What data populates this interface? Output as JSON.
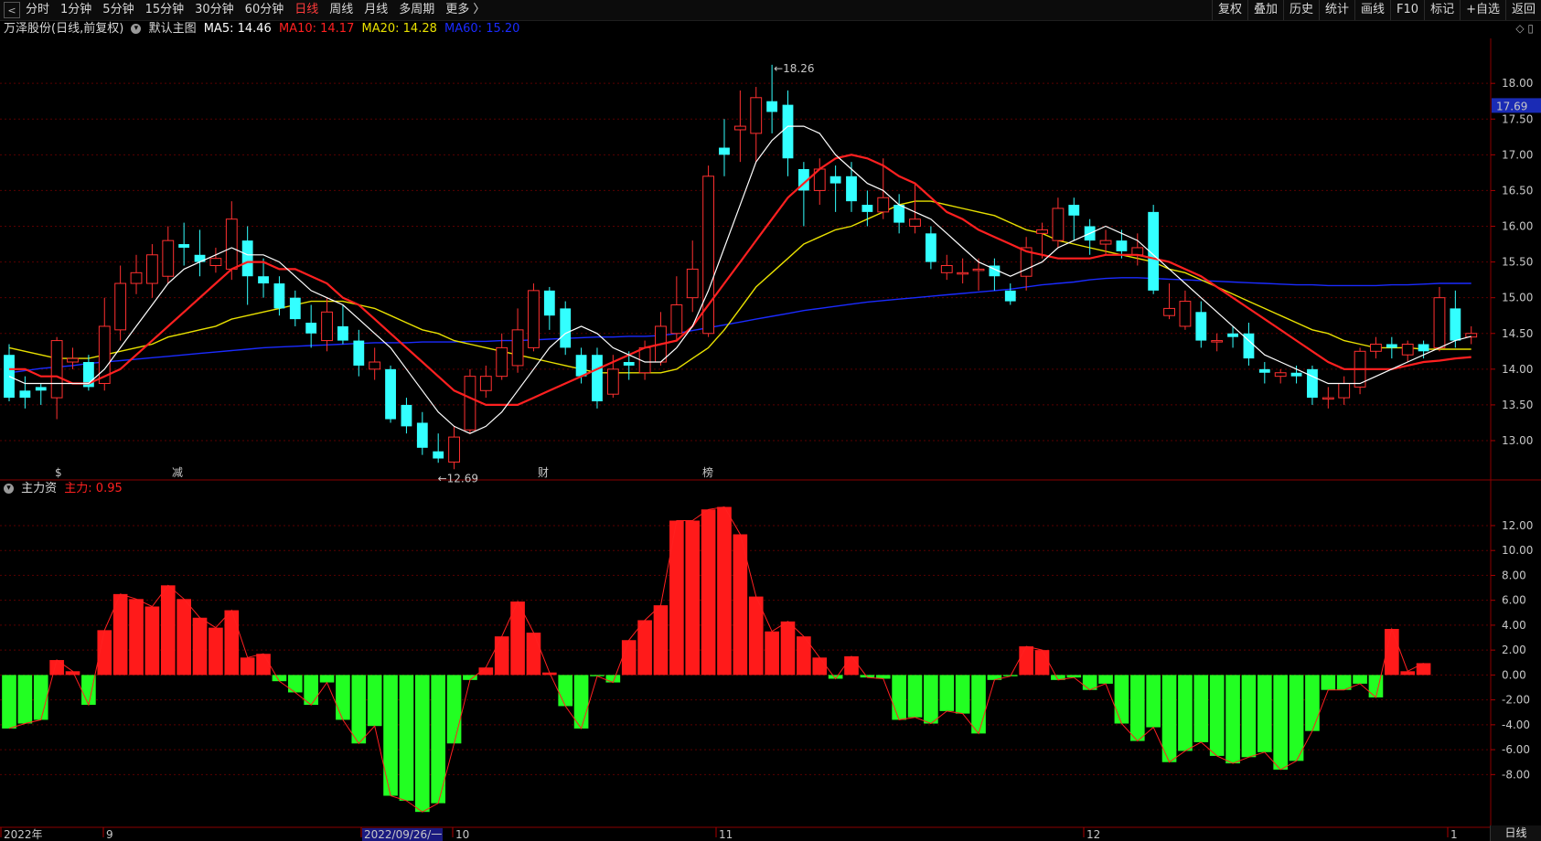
{
  "toolbar": {
    "back_icon": "back-arrow-icon",
    "periods": [
      "分时",
      "1分钟",
      "5分钟",
      "15分钟",
      "30分钟",
      "60分钟",
      "日线",
      "周线",
      "月线",
      "多周期",
      "更多 〉"
    ],
    "active_period": "日线",
    "right_tools": [
      "复权",
      "叠加",
      "历史",
      "统计",
      "画线",
      "F10",
      "标记",
      "+自选",
      "返回"
    ]
  },
  "main_info": {
    "stock": "万泽股份(日线,前复权)",
    "chart_name": "默认主图",
    "ma5": "MA5: 14.46",
    "ma10": "MA10: 14.17",
    "ma20": "MA20: 14.28",
    "ma60": "MA60: 15.20",
    "ma5_color": "#ffffff",
    "ma10_color": "#ff2020",
    "ma20_color": "#e8e000",
    "ma60_color": "#1a2bff"
  },
  "indicator_info": {
    "name": "主力资",
    "value": "主力: 0.95"
  },
  "price_axis_labels": [
    "18.00",
    "17.50",
    "17.00",
    "16.50",
    "16.00",
    "15.50",
    "15.00",
    "14.50",
    "14.00",
    "13.50",
    "13.00"
  ],
  "current_price": "17.69",
  "high_label": "18.26",
  "low_label": "12.69",
  "event_markers": [
    "$",
    "减",
    "财",
    "榜"
  ],
  "indicator_axis_labels": [
    "12.00",
    "10.00",
    "8.00",
    "6.00",
    "4.00",
    "2.00",
    "0.00",
    "-2.00",
    "-4.00",
    "-6.00",
    "-8.00"
  ],
  "date_labels": [
    "2022年",
    "9",
    "2022/09/26/一",
    "10",
    "11",
    "12",
    "1"
  ],
  "bottom_right_label": "日线",
  "colors": {
    "up": "#ff3030",
    "down": "#33ffff",
    "fund_up": "#ff1a1a",
    "fund_down": "#22ff22",
    "grid": "#5a0000",
    "background": "#000000"
  },
  "chart_data": [
    {
      "type": "candlestick",
      "title": "万泽股份(日线,前复权)",
      "ylim": [
        12.6,
        18.3
      ],
      "candles": [
        [
          14.2,
          13.6,
          14.35,
          13.55
        ],
        [
          13.7,
          13.6,
          13.9,
          13.45
        ],
        [
          13.75,
          13.7,
          13.8,
          13.5
        ],
        [
          13.6,
          14.4,
          14.45,
          13.3
        ],
        [
          14.1,
          14.15,
          14.3,
          14.0
        ],
        [
          14.1,
          13.75,
          14.2,
          13.7
        ],
        [
          13.8,
          14.6,
          15.0,
          13.7
        ],
        [
          14.55,
          15.2,
          15.45,
          14.4
        ],
        [
          15.2,
          15.35,
          15.6,
          15.05
        ],
        [
          15.2,
          15.6,
          15.75,
          15.0
        ],
        [
          15.3,
          15.8,
          16.0,
          15.2
        ],
        [
          15.75,
          15.7,
          16.05,
          15.45
        ],
        [
          15.6,
          15.5,
          15.95,
          15.3
        ],
        [
          15.45,
          15.55,
          15.7,
          15.35
        ],
        [
          15.4,
          16.1,
          16.35,
          15.25
        ],
        [
          15.8,
          15.3,
          16.0,
          14.9
        ],
        [
          15.3,
          15.2,
          15.55,
          15.0
        ],
        [
          15.2,
          14.85,
          15.3,
          14.75
        ],
        [
          15.0,
          14.7,
          15.1,
          14.6
        ],
        [
          14.65,
          14.5,
          14.9,
          14.3
        ],
        [
          14.4,
          14.8,
          15.0,
          14.25
        ],
        [
          14.6,
          14.4,
          14.9,
          14.35
        ],
        [
          14.4,
          14.05,
          14.55,
          13.9
        ],
        [
          14.0,
          14.1,
          14.3,
          13.85
        ],
        [
          14.0,
          13.3,
          14.05,
          13.25
        ],
        [
          13.5,
          13.2,
          13.6,
          13.1
        ],
        [
          13.25,
          12.9,
          13.4,
          12.8
        ],
        [
          12.85,
          12.75,
          13.1,
          12.69
        ],
        [
          12.7,
          13.05,
          13.2,
          12.6
        ],
        [
          13.15,
          13.9,
          14.0,
          13.1
        ],
        [
          13.7,
          13.9,
          14.05,
          13.6
        ],
        [
          13.9,
          14.3,
          14.5,
          13.85
        ],
        [
          14.05,
          14.55,
          14.85,
          13.95
        ],
        [
          14.3,
          15.1,
          15.2,
          14.25
        ],
        [
          15.1,
          14.75,
          15.15,
          14.55
        ],
        [
          14.85,
          14.3,
          14.95,
          14.2
        ],
        [
          14.2,
          13.9,
          14.3,
          13.8
        ],
        [
          14.2,
          13.55,
          14.3,
          13.45
        ],
        [
          13.65,
          14.0,
          14.2,
          13.6
        ],
        [
          14.1,
          14.05,
          14.25,
          13.85
        ],
        [
          13.95,
          14.3,
          14.4,
          13.85
        ],
        [
          14.1,
          14.6,
          14.8,
          14.05
        ],
        [
          14.5,
          14.9,
          15.3,
          14.4
        ],
        [
          15.0,
          15.4,
          15.8,
          14.8
        ],
        [
          14.5,
          16.7,
          16.85,
          14.45
        ],
        [
          17.1,
          17.0,
          17.5,
          16.7
        ],
        [
          17.35,
          17.4,
          17.9,
          16.9
        ],
        [
          17.3,
          17.8,
          17.95,
          16.9
        ],
        [
          17.75,
          17.6,
          18.26,
          17.3
        ],
        [
          17.7,
          16.95,
          17.9,
          16.7
        ],
        [
          16.8,
          16.5,
          16.9,
          16.0
        ],
        [
          16.5,
          16.8,
          16.95,
          16.3
        ],
        [
          16.7,
          16.6,
          16.85,
          16.2
        ],
        [
          16.7,
          16.35,
          16.9,
          16.2
        ],
        [
          16.3,
          16.2,
          16.5,
          16.0
        ],
        [
          16.2,
          16.4,
          16.95,
          16.1
        ],
        [
          16.3,
          16.05,
          16.45,
          15.9
        ],
        [
          16.0,
          16.1,
          16.6,
          15.9
        ],
        [
          15.9,
          15.5,
          16.0,
          15.4
        ],
        [
          15.35,
          15.45,
          15.6,
          15.25
        ],
        [
          15.35,
          15.35,
          15.55,
          15.2
        ],
        [
          15.4,
          15.4,
          15.55,
          15.1
        ],
        [
          15.45,
          15.3,
          15.55,
          15.1
        ],
        [
          15.1,
          14.95,
          15.2,
          14.9
        ],
        [
          15.3,
          15.7,
          15.85,
          15.1
        ],
        [
          15.9,
          15.95,
          16.05,
          15.55
        ],
        [
          15.8,
          16.25,
          16.4,
          15.7
        ],
        [
          16.3,
          16.15,
          16.4,
          15.8
        ],
        [
          16.0,
          15.8,
          16.1,
          15.6
        ],
        [
          15.75,
          15.8,
          15.95,
          15.6
        ],
        [
          15.8,
          15.65,
          15.95,
          15.55
        ],
        [
          15.6,
          15.7,
          15.9,
          15.45
        ],
        [
          16.2,
          15.1,
          16.3,
          15.05
        ],
        [
          14.75,
          14.85,
          15.2,
          14.7
        ],
        [
          14.6,
          14.95,
          15.1,
          14.55
        ],
        [
          14.8,
          14.4,
          14.95,
          14.3
        ],
        [
          14.4,
          14.4,
          14.5,
          14.25
        ],
        [
          14.5,
          14.45,
          14.6,
          14.3
        ],
        [
          14.5,
          14.15,
          14.65,
          14.05
        ],
        [
          14.0,
          13.95,
          14.1,
          13.8
        ],
        [
          13.9,
          13.95,
          14.0,
          13.8
        ],
        [
          13.95,
          13.9,
          14.05,
          13.8
        ],
        [
          14.0,
          13.6,
          14.05,
          13.5
        ],
        [
          13.6,
          13.6,
          13.75,
          13.45
        ],
        [
          13.6,
          13.8,
          13.9,
          13.5
        ],
        [
          13.75,
          14.25,
          14.3,
          13.65
        ],
        [
          14.25,
          14.35,
          14.45,
          14.15
        ],
        [
          14.35,
          14.3,
          14.45,
          14.15
        ],
        [
          14.2,
          14.35,
          14.4,
          14.1
        ],
        [
          14.35,
          14.25,
          14.4,
          14.15
        ],
        [
          14.3,
          15.0,
          15.15,
          14.25
        ],
        [
          14.85,
          14.4,
          15.1,
          14.3
        ],
        [
          14.45,
          14.5,
          14.6,
          14.35
        ]
      ],
      "ma5": [
        13.9,
        13.8,
        13.8,
        13.8,
        13.8,
        13.8,
        14.0,
        14.3,
        14.6,
        14.9,
        15.2,
        15.4,
        15.5,
        15.6,
        15.7,
        15.6,
        15.6,
        15.5,
        15.3,
        15.1,
        15.0,
        14.9,
        14.7,
        14.5,
        14.3,
        14.0,
        13.7,
        13.4,
        13.2,
        13.1,
        13.2,
        13.4,
        13.7,
        14.0,
        14.3,
        14.5,
        14.6,
        14.5,
        14.3,
        14.2,
        14.1,
        14.1,
        14.3,
        14.6,
        15.1,
        15.7,
        16.3,
        16.9,
        17.2,
        17.4,
        17.4,
        17.3,
        17.0,
        16.8,
        16.6,
        16.5,
        16.3,
        16.2,
        16.1,
        15.9,
        15.7,
        15.5,
        15.4,
        15.3,
        15.4,
        15.5,
        15.7,
        15.8,
        15.9,
        16.0,
        15.9,
        15.8,
        15.6,
        15.4,
        15.2,
        15.0,
        14.8,
        14.6,
        14.4,
        14.2,
        14.1,
        14.0,
        13.9,
        13.8,
        13.8,
        13.8,
        13.9,
        14.0,
        14.1,
        14.2,
        14.3,
        14.4,
        14.46
      ],
      "ma10": [
        14.0,
        14.0,
        13.9,
        13.9,
        13.8,
        13.8,
        13.9,
        14.0,
        14.2,
        14.4,
        14.6,
        14.8,
        15.0,
        15.2,
        15.4,
        15.5,
        15.5,
        15.4,
        15.4,
        15.3,
        15.2,
        15.0,
        14.9,
        14.7,
        14.5,
        14.3,
        14.1,
        13.9,
        13.7,
        13.6,
        13.5,
        13.5,
        13.5,
        13.6,
        13.7,
        13.8,
        13.9,
        14.0,
        14.1,
        14.2,
        14.3,
        14.35,
        14.4,
        14.6,
        14.9,
        15.2,
        15.5,
        15.8,
        16.1,
        16.4,
        16.6,
        16.8,
        16.95,
        17.0,
        16.95,
        16.85,
        16.7,
        16.6,
        16.4,
        16.2,
        16.1,
        15.95,
        15.85,
        15.75,
        15.65,
        15.6,
        15.55,
        15.55,
        15.55,
        15.6,
        15.6,
        15.6,
        15.55,
        15.5,
        15.4,
        15.3,
        15.15,
        15.0,
        14.85,
        14.7,
        14.55,
        14.4,
        14.25,
        14.1,
        14.0,
        14.0,
        14.0,
        14.0,
        14.05,
        14.1,
        14.12,
        14.15,
        14.17
      ],
      "ma20": [
        14.3,
        14.25,
        14.2,
        14.15,
        14.15,
        14.15,
        14.2,
        14.25,
        14.3,
        14.35,
        14.45,
        14.5,
        14.55,
        14.6,
        14.7,
        14.75,
        14.8,
        14.85,
        14.9,
        14.95,
        14.95,
        14.95,
        14.9,
        14.85,
        14.75,
        14.65,
        14.55,
        14.5,
        14.4,
        14.35,
        14.3,
        14.25,
        14.2,
        14.15,
        14.1,
        14.05,
        14.0,
        13.95,
        13.95,
        13.95,
        13.95,
        13.95,
        14.0,
        14.15,
        14.3,
        14.55,
        14.85,
        15.15,
        15.35,
        15.55,
        15.75,
        15.85,
        15.95,
        16.0,
        16.1,
        16.2,
        16.3,
        16.35,
        16.35,
        16.3,
        16.25,
        16.2,
        16.15,
        16.05,
        15.95,
        15.9,
        15.8,
        15.75,
        15.7,
        15.65,
        15.6,
        15.55,
        15.5,
        15.4,
        15.35,
        15.25,
        15.15,
        15.05,
        14.95,
        14.85,
        14.75,
        14.65,
        14.55,
        14.5,
        14.4,
        14.35,
        14.3,
        14.3,
        14.3,
        14.28,
        14.28,
        14.28,
        14.28
      ],
      "ma60": [
        13.95,
        13.98,
        14.01,
        14.03,
        14.05,
        14.08,
        14.1,
        14.12,
        14.14,
        14.16,
        14.18,
        14.2,
        14.22,
        14.24,
        14.26,
        14.28,
        14.3,
        14.31,
        14.32,
        14.33,
        14.34,
        14.35,
        14.36,
        14.37,
        14.37,
        14.37,
        14.38,
        14.38,
        14.38,
        14.39,
        14.39,
        14.4,
        14.4,
        14.41,
        14.42,
        14.43,
        14.44,
        14.45,
        14.45,
        14.46,
        14.46,
        14.47,
        14.5,
        14.54,
        14.58,
        14.62,
        14.66,
        14.7,
        14.74,
        14.78,
        14.82,
        14.85,
        14.88,
        14.91,
        14.94,
        14.96,
        14.98,
        15.0,
        15.02,
        15.04,
        15.06,
        15.08,
        15.1,
        15.12,
        15.15,
        15.18,
        15.2,
        15.22,
        15.25,
        15.27,
        15.28,
        15.28,
        15.27,
        15.26,
        15.25,
        15.24,
        15.23,
        15.22,
        15.21,
        15.2,
        15.19,
        15.18,
        15.18,
        15.17,
        15.17,
        15.17,
        15.17,
        15.18,
        15.18,
        15.19,
        15.2,
        15.2,
        15.2
      ]
    },
    {
      "type": "bar",
      "title": "主力资",
      "ylim": [
        -11.0,
        13.5
      ],
      "values": [
        -4.3,
        -3.9,
        -3.6,
        1.2,
        0.3,
        -2.4,
        3.6,
        6.5,
        6.1,
        5.5,
        7.2,
        6.1,
        4.6,
        3.8,
        5.2,
        1.4,
        1.7,
        -0.5,
        -1.4,
        -2.4,
        -0.6,
        -3.6,
        -5.5,
        -4.1,
        -9.7,
        -10.1,
        -11.0,
        -10.3,
        -5.5,
        -0.4,
        0.6,
        3.1,
        5.9,
        3.4,
        0.2,
        -2.5,
        -4.3,
        -0.1,
        -0.6,
        2.8,
        4.4,
        5.6,
        12.4,
        12.4,
        13.3,
        13.5,
        11.3,
        6.3,
        3.5,
        4.3,
        3.1,
        1.4,
        -0.3,
        1.5,
        -0.2,
        -0.3,
        -3.6,
        -3.4,
        -3.9,
        -2.9,
        -3.1,
        -4.7,
        -0.4,
        -0.1,
        2.3,
        2.0,
        -0.4,
        -0.2,
        -1.2,
        -0.7,
        -3.9,
        -5.3,
        -4.2,
        -7.0,
        -6.1,
        -5.4,
        -6.5,
        -7.1,
        -6.6,
        -6.2,
        -7.6,
        -6.9,
        -4.5,
        -1.2,
        -1.2,
        -0.7,
        -1.8,
        3.7,
        0.3,
        0.95
      ]
    }
  ]
}
